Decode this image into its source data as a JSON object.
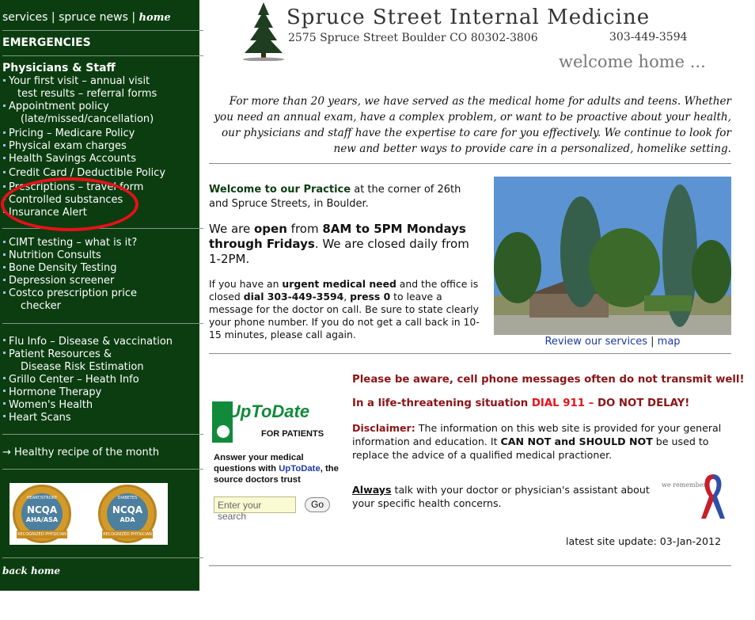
{
  "sidebar": {
    "top_nav": {
      "services": "services",
      "sep1": "|",
      "news": "spruce news",
      "sep2": "|",
      "home": "home"
    },
    "emergencies": "EMERGENCIES",
    "physicians_staff": "Physicians & Staff",
    "group1": [
      "Your first visit – annual visit",
      "test results – referral forms",
      "Appointment policy",
      "(late/missed/cancellation)",
      "Pricing – Medicare Policy",
      "Physical exam charges",
      "Health Savings Accounts",
      "Credit Card / Deductible Policy",
      "Prescriptions – travel form",
      "Controlled substances",
      "Insurance Alert"
    ],
    "group2": [
      "CIMT testing – what is it?",
      "Nutrition Consults",
      "Bone Density Testing",
      "Depression screener",
      "Costco prescription price",
      "checker"
    ],
    "group3": [
      "Flu Info – Disease & vaccination",
      "Patient Resources &",
      "Disease Risk Estimation",
      "Grillo Center – Heath Info",
      "Hormone Therapy",
      "Women's Health",
      "Heart Scans"
    ],
    "healthy_recipe": "→ Healthy recipe of the month",
    "badges": [
      {
        "top": "HEART/STROKE",
        "org": "NCQA",
        "sub": "AHA/ASA",
        "ribbon": "RECOGNIZED PHYSICIAN"
      },
      {
        "top": "DIABETES",
        "org": "NCQA",
        "sub": "ADA",
        "ribbon": "RECOGNIZED PHYSICIAN"
      }
    ],
    "back_home": "back home"
  },
  "header": {
    "title": "Spruce Street Internal Medicine",
    "address": "2575 Spruce Street  Boulder CO  80302-3806",
    "phone": "303-449-3594",
    "welcome": "welcome home ..."
  },
  "intro": "For more than 20 years, we have served as the medical home for adults and teens.  Whether you need an annual exam, have a complex problem, or want to be proactive about your health, our physicians and staff have the expertise to care for you effectively.  We continue to look for new and better ways to provide care in a personalized, homelike setting.",
  "welcome_block": {
    "heading": "Welcome to our Practice",
    "heading_rest": " at the corner of 26th and Spruce Streets, in Boulder.",
    "hours_pre": "We are ",
    "hours_open": "open",
    "hours_mid": " from ",
    "hours_time": "8AM to 5PM Mondays through Fridays",
    "hours_post": ". We are closed daily from 1-2PM.",
    "urgent_pre": "If you have an ",
    "urgent_bold": "urgent medical need",
    "urgent_mid": " and the office is closed ",
    "urgent_dial": "dial 303-449-3594",
    "urgent_comma": ", ",
    "urgent_press": "press 0",
    "urgent_post": " to leave a message for the doctor on call. Be sure to state clearly your phone number. If you do not get a call back in 10-15 minutes, please call again.",
    "review_link": "Review our services",
    "caption_sep": "|",
    "map_link": "map"
  },
  "uptodate": {
    "brand": "UpToDate",
    "for_patients": "FOR PATIENTS",
    "text_pre": "Answer your medical questions with ",
    "text_brand": "UpToDate",
    "text_post": ", the source doctors trust",
    "search_placeholder": "Enter your search",
    "go": "Go"
  },
  "notices": {
    "cell_warning": "Please be aware, cell phone messages often do not transmit well!",
    "life_pre": "In a life-threatening situation ",
    "life_dial": "DIAL 911 –",
    "life_post": " DO NOT DELAY!",
    "disclaimer_label": "Disclaimer:",
    "disclaimer_pre": " The information on this web site is provided for your general information and education. It ",
    "disclaimer_bold": "CAN NOT and SHOULD NOT",
    "disclaimer_post": " be used to replace the advice of a qualified medical practioner.",
    "always_bold": "Always",
    "always_rest": " talk with your doctor or physician's assistant about your specific health concerns.",
    "we_remember": "we remember",
    "update_label": "latest site update:",
    "update_date": "03-Jan-2012"
  },
  "colors": {
    "sidebar_bg": "#0b3d10",
    "dark_red": "#8b1416",
    "alert_red": "#e8101a",
    "link_blue": "#1e3aa8",
    "uptodate_green": "#118a3a"
  }
}
